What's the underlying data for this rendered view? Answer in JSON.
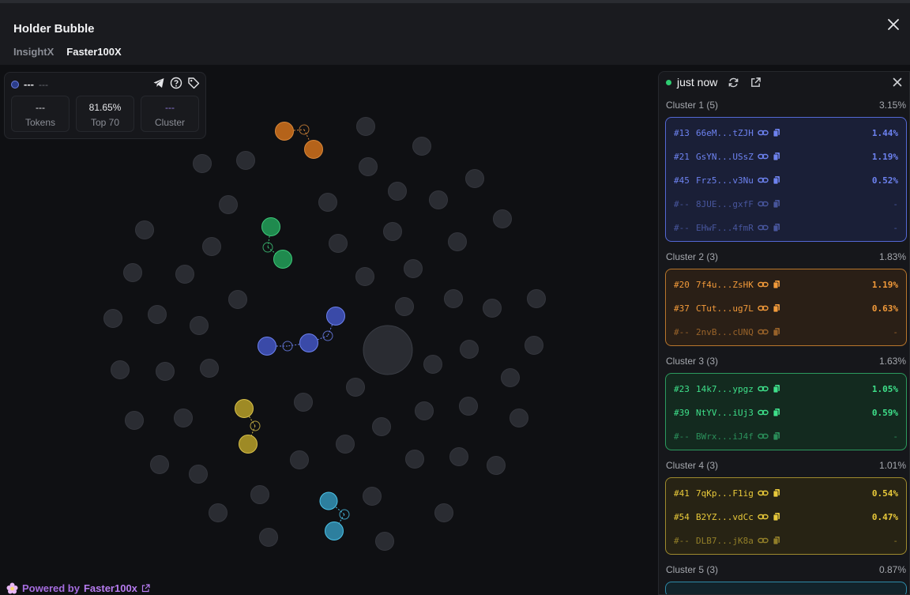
{
  "header": {
    "title": "Holder Bubble",
    "tabs": [
      "InsightX",
      "Faster100X"
    ],
    "active_tab": 1
  },
  "info": {
    "name": "---",
    "sub": "---",
    "stats": [
      {
        "value": "---",
        "label": "Tokens"
      },
      {
        "value": "81.65%",
        "label": "Top 70"
      },
      {
        "value": "---",
        "label": "Cluster"
      }
    ]
  },
  "panel": {
    "status": "just now",
    "clusters": [
      {
        "title": "Cluster 1 (5)",
        "pct": "3.15%",
        "color": "#5468d4",
        "bg": "#1a1f37",
        "text": "#6d82f0",
        "rows": [
          {
            "rank": "#13",
            "addr": "66eM...tZJH",
            "pct": "1.44%"
          },
          {
            "rank": "#21",
            "addr": "GsYN...USsZ",
            "pct": "1.19%"
          },
          {
            "rank": "#45",
            "addr": "Frz5...v3Nu",
            "pct": "0.52%"
          },
          {
            "rank": "#--",
            "addr": "8JUE...gxfF",
            "pct": "-"
          },
          {
            "rank": "#--",
            "addr": "EHwF...4fmR",
            "pct": "-"
          }
        ]
      },
      {
        "title": "Cluster 2 (3)",
        "pct": "1.83%",
        "color": "#b8762c",
        "bg": "#2a1f16",
        "text": "#f29a3a",
        "rows": [
          {
            "rank": "#20",
            "addr": "7f4u...ZsHK",
            "pct": "1.19%"
          },
          {
            "rank": "#37",
            "addr": "CTut...ug7L",
            "pct": "0.63%"
          },
          {
            "rank": "#--",
            "addr": "2nvB...cUNQ",
            "pct": "-"
          }
        ]
      },
      {
        "title": "Cluster 3 (3)",
        "pct": "1.63%",
        "color": "#2c9a5e",
        "bg": "#132a1f",
        "text": "#3ee08a",
        "rows": [
          {
            "rank": "#23",
            "addr": "14k7...ypgz",
            "pct": "1.05%"
          },
          {
            "rank": "#39",
            "addr": "NtYV...iUj3",
            "pct": "0.59%"
          },
          {
            "rank": "#--",
            "addr": "BWrx...iJ4f",
            "pct": "-"
          }
        ]
      },
      {
        "title": "Cluster 4 (3)",
        "pct": "1.01%",
        "color": "#9e8a2e",
        "bg": "#272314",
        "text": "#e8c93a",
        "rows": [
          {
            "rank": "#41",
            "addr": "7qKp...F1ig",
            "pct": "0.54%"
          },
          {
            "rank": "#54",
            "addr": "B2YZ...vdCc",
            "pct": "0.47%"
          },
          {
            "rank": "#--",
            "addr": "DLB7...jK8a",
            "pct": "-"
          }
        ]
      },
      {
        "title": "Cluster 5 (3)",
        "pct": "0.87%",
        "color": "#2e8aa8",
        "bg": "#12232a",
        "text": "#4cc3e8",
        "rows": []
      }
    ]
  },
  "footer": {
    "prefix": "Powered by",
    "brand": "Faster100x"
  },
  "bubble_colors": {
    "gray": "#2a2c32",
    "blue": "#3a4aa8",
    "orange": "#b5631a",
    "green": "#1f8a4e",
    "yellow": "#9e8a25",
    "cyan": "#2d7f9e"
  }
}
